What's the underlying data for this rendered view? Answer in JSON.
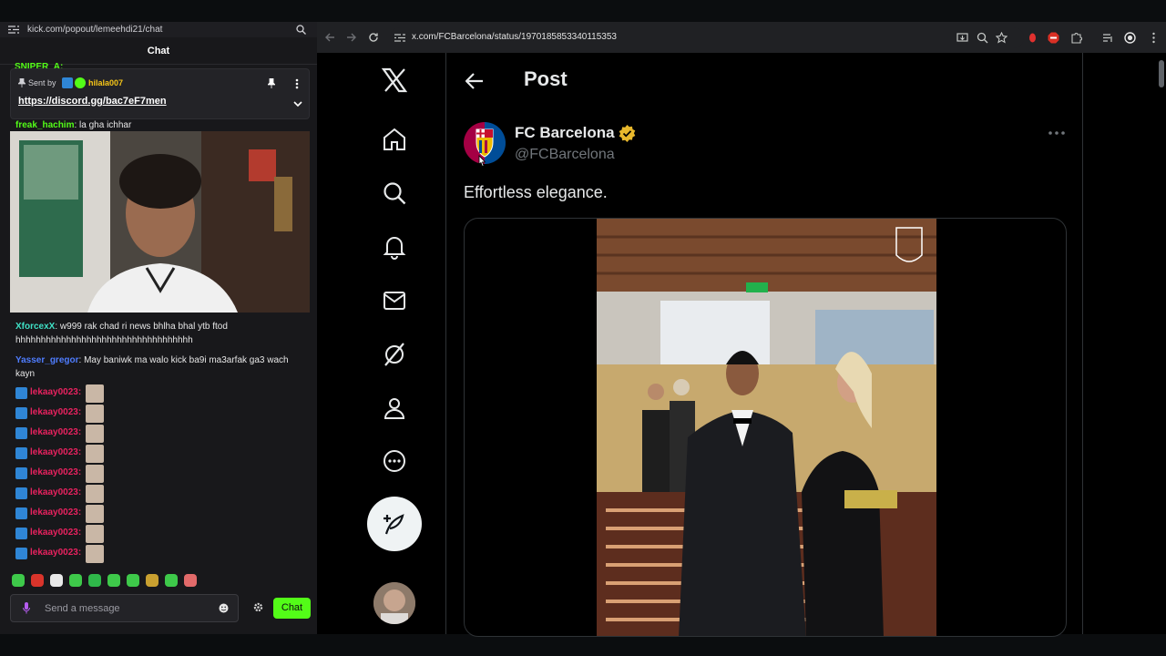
{
  "chat_window": {
    "url": "kick.com/popout/lemeehdi21/chat",
    "header_title": "Chat",
    "top_cut_user": "SNIPER_A:",
    "pinned": {
      "sent_by_label": "Sent by",
      "user": "hilala007",
      "link": "https://discord.gg/bac7eF7men"
    },
    "messages": [
      {
        "user": "freak_hachim",
        "user_color": "#53fc18",
        "text": "la gha ichhar"
      },
      {
        "user": "XforcexX",
        "user_color": "#3fe0c5",
        "text": "w999 rak chad ri news bhlha bhal ytb ftod hhhhhhhhhhhhhhhhhhhhhhhhhhhhhhhhhhh"
      },
      {
        "user": "Yasser_gregor",
        "user_color": "#4f7dff",
        "text": "May baniwk ma walo kick ba9i ma3arfak ga3 wach kayn"
      }
    ],
    "spam_user": "lekaay0023:",
    "spam_count": 9,
    "composer_placeholder": "Send a message",
    "chat_button": "Chat"
  },
  "browser": {
    "url": "x.com/FCBarcelona/status/1970185853340115353"
  },
  "x_post": {
    "page_title": "Post",
    "display_name": "FC Barcelona",
    "handle": "@FCBarcelona",
    "text": "Effortless elegance."
  },
  "colors": {
    "kick_green": "#53fc18",
    "x_text": "#e7e9ea",
    "x_muted": "#71767b",
    "verified_gold": "#e8b82c"
  }
}
